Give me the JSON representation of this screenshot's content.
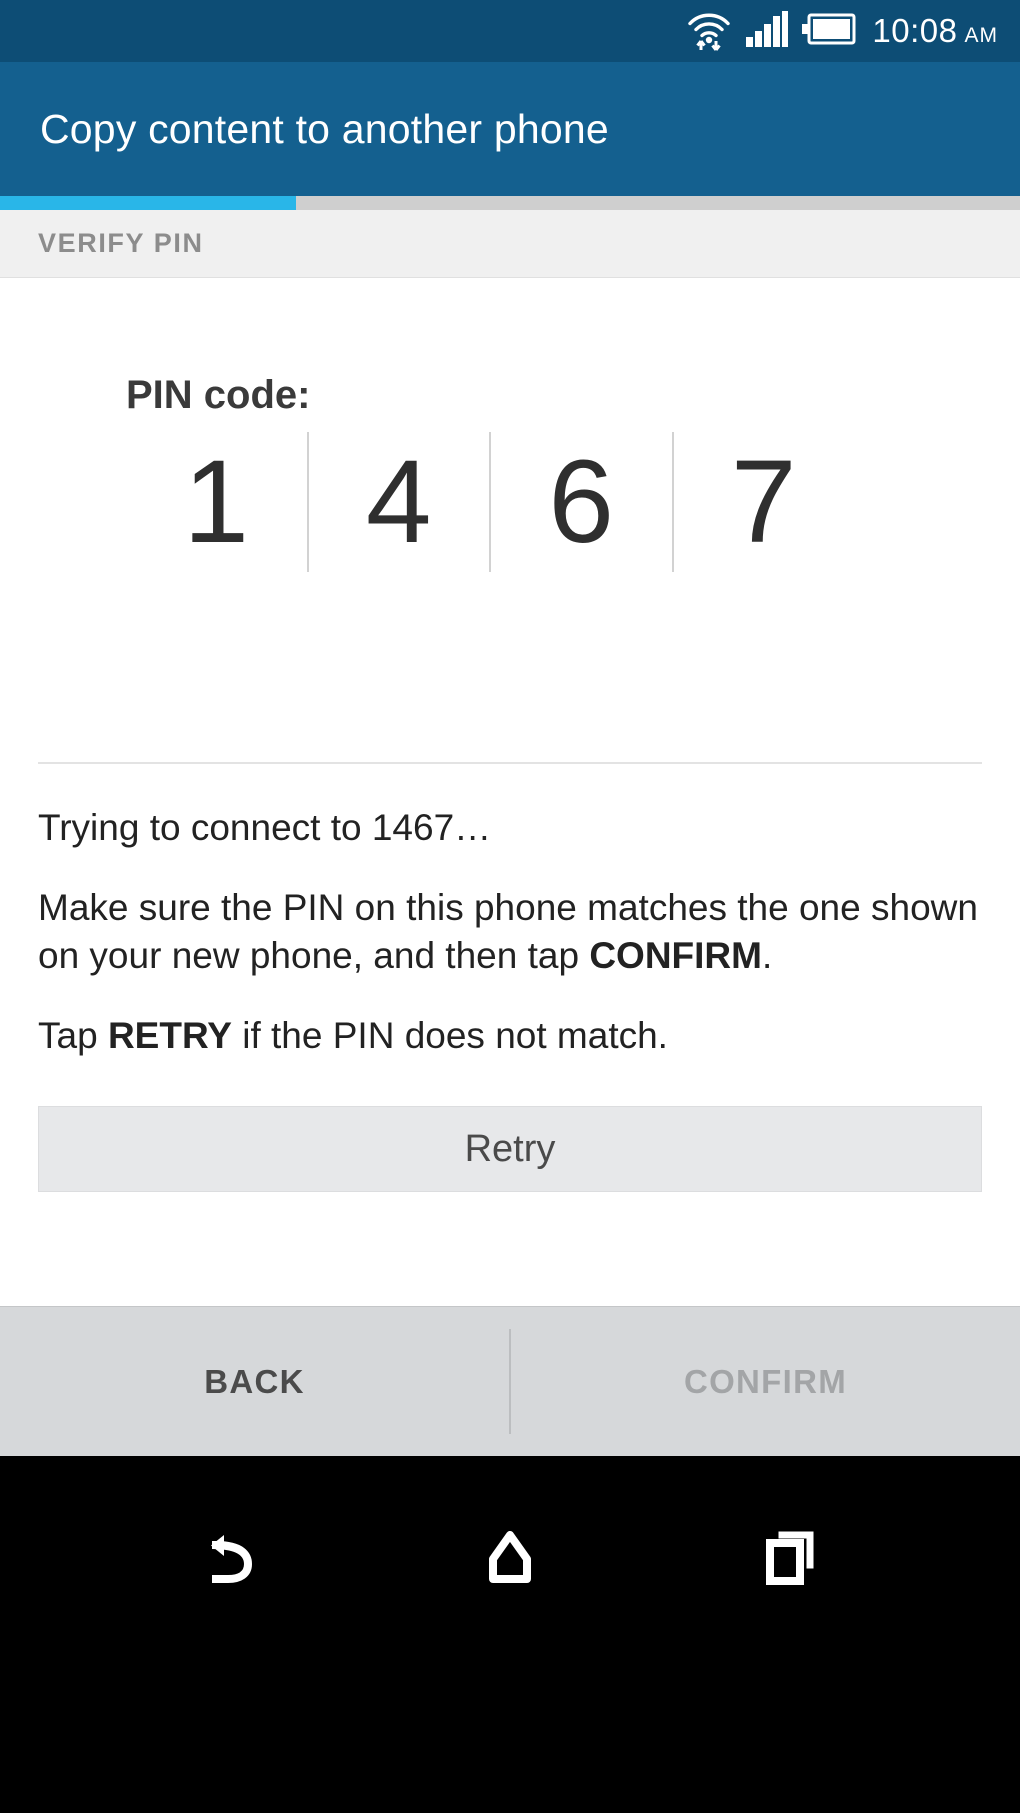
{
  "statusbar": {
    "time": "10:08",
    "ampm": "AM",
    "icons": [
      "wifi-transfer-icon",
      "signal-bars-icon",
      "battery-icon"
    ]
  },
  "actionbar": {
    "title": "Copy content to another phone",
    "bg_color": "#14608f"
  },
  "progress": {
    "percent": 29,
    "fill_color": "#29b6e8",
    "track_color": "#cfcfcf"
  },
  "step": {
    "label": "VERIFY PIN"
  },
  "pin": {
    "heading": "PIN code:",
    "digits": [
      "1",
      "4",
      "6",
      "7"
    ]
  },
  "body": {
    "status_line": "Trying to connect to 1467…",
    "instruction_pre": "Make sure the PIN on this phone matches the one shown on your new phone, and then tap ",
    "instruction_bold": "CONFIRM",
    "instruction_post": ".",
    "retry_pre": "Tap ",
    "retry_bold": "RETRY",
    "retry_post": " if the PIN does not match."
  },
  "retry_button": {
    "label": "Retry"
  },
  "bottombar": {
    "back_label": "BACK",
    "confirm_label": "CONFIRM",
    "back_enabled": true,
    "confirm_enabled": false
  },
  "navbar": {
    "buttons": [
      "back-nav-icon",
      "home-nav-icon",
      "recents-nav-icon"
    ]
  }
}
